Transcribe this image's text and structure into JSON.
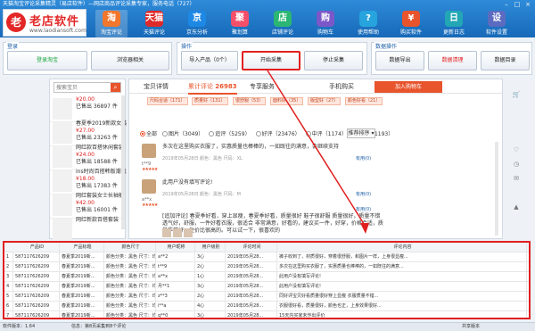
{
  "app": {
    "title": "天猫淘宝评论采集精灵（易店软件）—网店商品评论采集专家，服务电话（727）"
  },
  "logo": {
    "mark": "老",
    "name": "老店软件",
    "url": "www.laodiansoft.com"
  },
  "nav": [
    {
      "label": "淘宝评论",
      "glyph": "淘",
      "color": "#f2762c"
    },
    {
      "label": "天猫评论",
      "glyph": "天猫",
      "color": "#e02a2a"
    },
    {
      "label": "京东分析",
      "glyph": "京",
      "color": "#1e88e5"
    },
    {
      "label": "聚划算",
      "glyph": "聚",
      "color": "#f44f6a"
    },
    {
      "label": "店铺评论",
      "glyph": "店",
      "color": "#2bb673"
    },
    {
      "label": "购物车",
      "glyph": "购",
      "color": "#7b57c8"
    },
    {
      "label": "使用帮助",
      "glyph": "?",
      "color": "#27a3dd"
    },
    {
      "label": "购买软件",
      "glyph": "¥",
      "color": "#e8542c"
    },
    {
      "label": "更新日志",
      "glyph": "日",
      "color": "#23a7b5"
    },
    {
      "label": "软件设置",
      "glyph": "设",
      "color": "#5c6bc0"
    }
  ],
  "groups": {
    "login": {
      "label": "登录",
      "buttons": [
        "登录淘宝",
        "浏览器相关"
      ]
    },
    "operation": {
      "label": "操作",
      "buttons": [
        "导入产品（0个）",
        "开始采集",
        "停止采集"
      ]
    },
    "data": {
      "label": "数据操作",
      "buttons": [
        "数据导出",
        "数据清理",
        "数据目录"
      ]
    }
  },
  "search": {
    "placeholder": "搜索宝贝"
  },
  "products": [
    {
      "line1": "¥20.00",
      "line2": "已售出 36897 件",
      "line3": ""
    },
    {
      "line1": "春夏季2019新款女装",
      "line2": "¥27.00",
      "line3": "已售出 23263 件"
    },
    {
      "line1": "网红款百搭休闲套装",
      "line2": "¥24.00",
      "line3": "已售出 18588 件"
    },
    {
      "line1": "ins时尚百搭韩版潮流",
      "line2": "¥18.00",
      "line3": "已售出 17383 件"
    },
    {
      "line1": "网红套装女士长袖裤",
      "line2": "¥42.00",
      "line3": "已售出 16001 件"
    },
    {
      "line1": "网红新款百搭套装",
      "line2": "",
      "line3": ""
    }
  ],
  "tabs": {
    "detail": "宝贝详情",
    "reviews_label": "累计评论",
    "reviews_count": "26983",
    "service": "专享服务",
    "mobile": "手机购买",
    "cart": "加入购物车"
  },
  "tags": [
    "尺码合适（171）",
    "质量好（131）",
    "很舒服（53）",
    "面料好（35）",
    "版型好（27）",
    "颜色好看（21）"
  ],
  "filters": [
    {
      "label": "全部",
      "on": true
    },
    {
      "label": "图片（3049）",
      "on": false
    },
    {
      "label": "追评（5259）",
      "on": false
    },
    {
      "label": "好评（23476）",
      "on": false
    },
    {
      "label": "中评（1174）",
      "on": false
    },
    {
      "label": "差评（1193）",
      "on": false
    }
  ],
  "sort_label": "推荐排序",
  "reviews": [
    {
      "text": "多次在这里购买衣服了，实惠质量也棒棒的，一如既往的满意，会继续支持",
      "name": "t**9",
      "date": "2019年05月28日 颜色：黑色 尺码：XL",
      "like": "有用(0)",
      "stars": "★★★★★"
    },
    {
      "text": "此用户没有填写评论!",
      "name": "a**x",
      "date": "2019年05月28日 颜色：黑色 尺码：M",
      "like": "有用(0)",
      "stars": "★★★★★"
    },
    {
      "text": "[追加评论] 春夏季好看，穿上显瘦，春夏季好看，质量很好 鞋子很舒服 质量很好，质量不错 透气好，舒服，一件好看衣服，很适合 非常满意，好看的，建议买一件，好穿，价格合适，质量非常好，性价比很高的。可以试一下，很喜欢的",
      "name": "",
      "date": "",
      "like": "有用(0)",
      "stars": ""
    }
  ],
  "table": {
    "headers": [
      "产品ID",
      "产品标题",
      "颜色尺寸",
      "用户昵称",
      "用户级别",
      "评论时间",
      "评论内容"
    ],
    "rows": [
      [
        "587117626209",
        "春夏季2019新...",
        "颜色分类：黑色 尺寸：均码...",
        "a**2",
        "3心",
        "2019年05月28...",
        "裤子收到了，材质很好，穿着很舒服，和图片一样，上身很显瘦..."
      ],
      [
        "587117626209",
        "春夏季2019新...",
        "颜色分类：黑色 尺寸：均码...",
        "t**9",
        "2心",
        "2019年05月28...",
        "多次在这里购买衣服了，实惠质量也棒棒的，一如既往的满意..."
      ],
      [
        "587117626209",
        "春夏季2019新...",
        "颜色分类：黑色 尺寸：均码...",
        "a**x",
        "1心",
        "2019年05月28...",
        "此用户没有填写评论!"
      ],
      [
        "587117626209",
        "春夏季2019新...",
        "颜色分类：黑色 尺寸：均码...",
        "月**1",
        "3心",
        "2019年05月28...",
        "此用户没有填写评论!"
      ],
      [
        "587117626209",
        "春夏季2019新...",
        "颜色分类：黑色 尺寸：均码...",
        "z**3",
        "2心",
        "2019年05月28...",
        "同好评宝贝好看质量很好穿上显瘦 衣服质量不错..."
      ],
      [
        "587117626209",
        "春夏季2019新...",
        "颜色分类：黑色 尺寸：均码...",
        "i**a",
        "4心",
        "2019年05月28...",
        "衣服很好看，质量很好，颜色也正，上身效果很好..."
      ],
      [
        "587117626209",
        "春夏季2019新...",
        "颜色分类：黑色 尺寸：均码...",
        "q**0",
        "3心",
        "2019年05月28...",
        "15天内买家未作出评价"
      ]
    ]
  },
  "status": {
    "version": "软件版本：1.64",
    "info": "信息：第8页采集到8个评论",
    "share": "共享版本"
  }
}
